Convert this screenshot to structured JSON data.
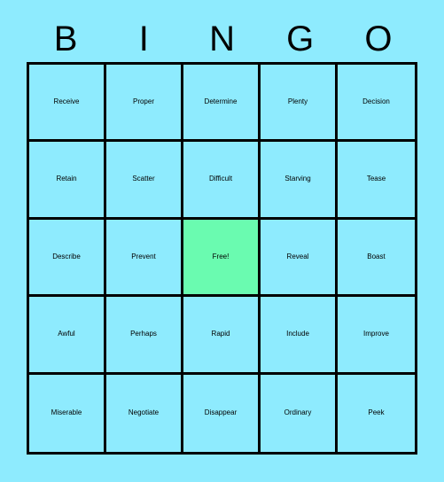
{
  "card": {
    "background_color": "#8eebfe",
    "grid_line_color": "#000000",
    "free_cell_color": "#6afbb0",
    "text_color": "#000000"
  },
  "header": {
    "letters": [
      {
        "label": "B"
      },
      {
        "label": "I"
      },
      {
        "label": "N"
      },
      {
        "label": "G"
      },
      {
        "label": "O"
      }
    ]
  },
  "grid": {
    "rows": 5,
    "columns": 5,
    "cells": [
      [
        {
          "label": "Receive",
          "size": "md",
          "free": false
        },
        {
          "label": "Proper",
          "size": "lg",
          "free": false
        },
        {
          "label": "Determine",
          "size": "xs",
          "free": false
        },
        {
          "label": "Plenty",
          "size": "lg",
          "free": false
        },
        {
          "label": "Decision",
          "size": "sm",
          "free": false
        }
      ],
      [
        {
          "label": "Retain",
          "size": "lg",
          "free": false
        },
        {
          "label": "Scatter",
          "size": "md",
          "free": false
        },
        {
          "label": "Difficult",
          "size": "md",
          "free": false
        },
        {
          "label": "Starving",
          "size": "sm",
          "free": false
        },
        {
          "label": "Tease",
          "size": "lg",
          "free": false
        }
      ],
      [
        {
          "label": "Describe",
          "size": "sm",
          "free": false
        },
        {
          "label": "Prevent",
          "size": "md",
          "free": false
        },
        {
          "label": "Free!",
          "size": "xl",
          "free": true
        },
        {
          "label": "Reveal",
          "size": "md",
          "free": false
        },
        {
          "label": "Boast",
          "size": "lg",
          "free": false
        }
      ],
      [
        {
          "label": "Awful",
          "size": "xl",
          "free": false
        },
        {
          "label": "Perhaps",
          "size": "sm",
          "free": false
        },
        {
          "label": "Rapid",
          "size": "xl",
          "free": false
        },
        {
          "label": "Include",
          "size": "md",
          "free": false
        },
        {
          "label": "Improve",
          "size": "sm",
          "free": false
        }
      ],
      [
        {
          "label": "Miserable",
          "size": "xs",
          "free": false
        },
        {
          "label": "Negotiate",
          "size": "xs",
          "free": false
        },
        {
          "label": "Disappear",
          "size": "xs",
          "free": false
        },
        {
          "label": "Ordinary",
          "size": "sm",
          "free": false
        },
        {
          "label": "Peek",
          "size": "xl",
          "free": false
        }
      ]
    ]
  }
}
